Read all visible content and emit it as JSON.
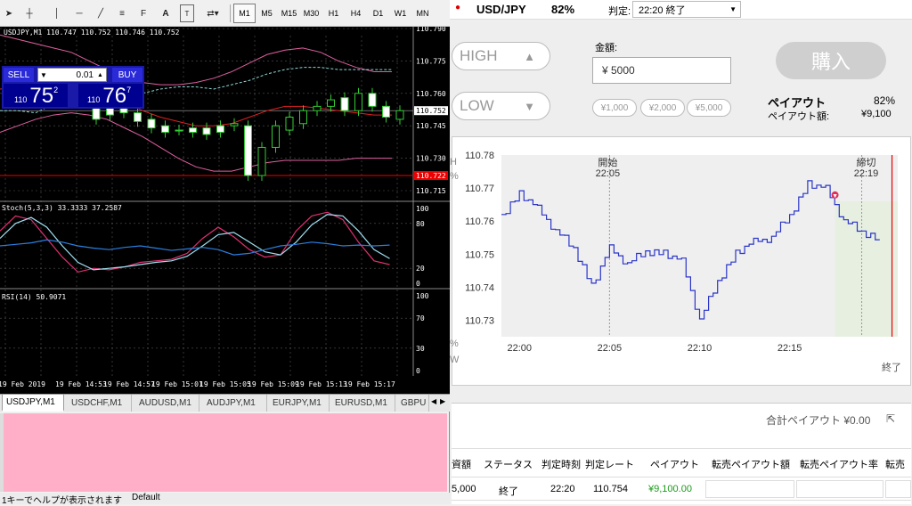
{
  "mt4": {
    "toolbar": {
      "timeframes": [
        "M1",
        "M5",
        "M15",
        "M30",
        "H1",
        "H4",
        "D1",
        "W1",
        "MN"
      ],
      "active_tf": "M1"
    },
    "chart": {
      "title": "USDJPY,M1  110.747 110.752 110.746 110.752",
      "price_labels": [
        "110.790",
        "110.775",
        "110.760",
        "110.745",
        "110.730",
        "110.715"
      ],
      "current_price": "110.752",
      "red_line_price": "110.722",
      "stoch_label": "Stoch(5,3,3) 33.3333 37.2587",
      "stoch_levels": [
        "100",
        "80",
        "20",
        "0"
      ],
      "rsi_label": "RSI(14) 50.9071",
      "rsi_levels": [
        "100",
        "70",
        "30",
        "0"
      ],
      "time_labels": [
        "19 Feb 2019",
        "19 Feb 14:53",
        "19 Feb 14:57",
        "19 Feb 15:01",
        "19 Feb 15:05",
        "19 Feb 15:09",
        "19 Feb 15:13",
        "19 Feb 15:17"
      ]
    },
    "trade_panel": {
      "sell_label": "SELL",
      "buy_label": "BUY",
      "lot": "0.01",
      "sell_prefix": "110",
      "sell_big": "75",
      "sell_sup": "2",
      "buy_prefix": "110",
      "buy_big": "76",
      "buy_sup": "7"
    },
    "symbol_tabs": [
      "USDJPY,M1",
      "USDCHF,M1",
      "AUDUSD,M1",
      "AUDJPY,M1",
      "EURJPY,M1",
      "EURUSD,M1",
      "GBPU"
    ],
    "active_tab": "USDJPY,M1",
    "status": {
      "left": "1キーでヘルプが表示されます",
      "right": "Default"
    }
  },
  "bo": {
    "symbol": "USD/JPY",
    "payout_rate": "82%",
    "judge_label": "判定:",
    "judge_value": "22:20 終了",
    "high_label": "HIGH",
    "low_label": "LOW",
    "amount_label": "金額:",
    "amount_value": "¥ 5000",
    "quick_amounts": [
      "¥1,000",
      "¥2,000",
      "¥5,000"
    ],
    "buy_label": "購入",
    "payout_label": "ペイアウト",
    "payout_value": "82%",
    "payout_amount_label": "ペイアウト額:",
    "payout_amount_value": "¥9,100",
    "graph": {
      "start_label": "開始",
      "start_time": "22:05",
      "end_label": "締切",
      "end_time": "22:19",
      "y_ticks": [
        "110.78",
        "110.77",
        "110.76",
        "110.75",
        "110.74",
        "110.73"
      ],
      "x_ticks": [
        "22:00",
        "22:05",
        "22:10",
        "22:15"
      ],
      "end_caption": "終了",
      "left_edge_glyphs": [
        "H",
        "%",
        "%",
        "W"
      ]
    },
    "total_payout_label": "合計ペイアウト ¥0.00",
    "table": {
      "headers": [
        "資額",
        "ステータス",
        "判定時刻",
        "判定レート",
        "ペイアウト",
        "転売ペイアウト額",
        "転売ペイアウト率",
        "転売"
      ],
      "row": [
        "5,000",
        "終了",
        "22:20",
        "110.754",
        "¥9,100.00",
        "",
        "",
        ""
      ]
    }
  },
  "chart_data": {
    "type": "line",
    "title": "",
    "xlabel": "",
    "ylabel": "",
    "x_ticks": [
      "22:00",
      "22:05",
      "22:10",
      "22:15"
    ],
    "ylim": [
      110.725,
      110.78
    ],
    "series": [
      {
        "x": [
          "21:59",
          "22:00",
          "22:01",
          "22:02",
          "22:03",
          "22:04",
          "22:05",
          "22:06",
          "22:07",
          "22:08",
          "22:09",
          "22:10",
          "22:11",
          "22:12",
          "22:13",
          "22:14",
          "22:15",
          "22:16",
          "22:17",
          "22:18",
          "22:19",
          "22:20"
        ],
        "values": [
          110.762,
          110.768,
          110.764,
          110.757,
          110.752,
          110.74,
          110.752,
          110.747,
          110.751,
          110.75,
          110.748,
          110.73,
          110.742,
          110.75,
          110.754,
          110.755,
          110.762,
          110.771,
          110.77,
          110.76,
          110.757,
          110.754
        ]
      }
    ],
    "grid": true
  }
}
